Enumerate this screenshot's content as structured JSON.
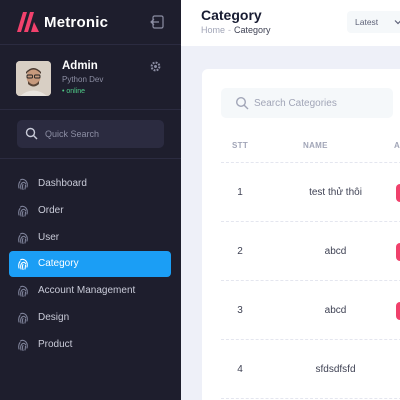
{
  "app": {
    "brand_name": "Metronic"
  },
  "user": {
    "name": "Admin",
    "role": "Python Dev",
    "status": "• online"
  },
  "sidebar": {
    "search_placeholder": "Quick Search",
    "items": [
      {
        "label": "Dashboard",
        "icon": "fingerprint-icon",
        "active": false
      },
      {
        "label": "Order",
        "icon": "fingerprint-icon",
        "active": false
      },
      {
        "label": "User",
        "icon": "fingerprint-icon",
        "active": false
      },
      {
        "label": "Category",
        "icon": "fingerprint-icon",
        "active": true
      },
      {
        "label": "Account Management",
        "icon": "fingerprint-icon",
        "active": false
      },
      {
        "label": "Design",
        "icon": "fingerprint-icon",
        "active": false
      },
      {
        "label": "Product",
        "icon": "fingerprint-icon",
        "active": false
      }
    ]
  },
  "header": {
    "title": "Category",
    "breadcrumb": {
      "home": "Home",
      "separator": "-",
      "current": "Category"
    },
    "sort_select": {
      "selected": "Latest"
    }
  },
  "table": {
    "search_placeholder": "Search Categories",
    "columns": [
      "STT",
      "NAME",
      "A"
    ],
    "rows": [
      {
        "stt": "1",
        "name": "test thử thôi"
      },
      {
        "stt": "2",
        "name": "abcd"
      },
      {
        "stt": "3",
        "name": "abcd"
      },
      {
        "stt": "4",
        "name": "sfdsdfsfd"
      }
    ]
  },
  "colors": {
    "sidebar_bg": "#1e1e2d",
    "accent": "#1b9ef5",
    "danger": "#f1416c",
    "online": "#50cd89",
    "page_bg": "#eef0f8"
  }
}
